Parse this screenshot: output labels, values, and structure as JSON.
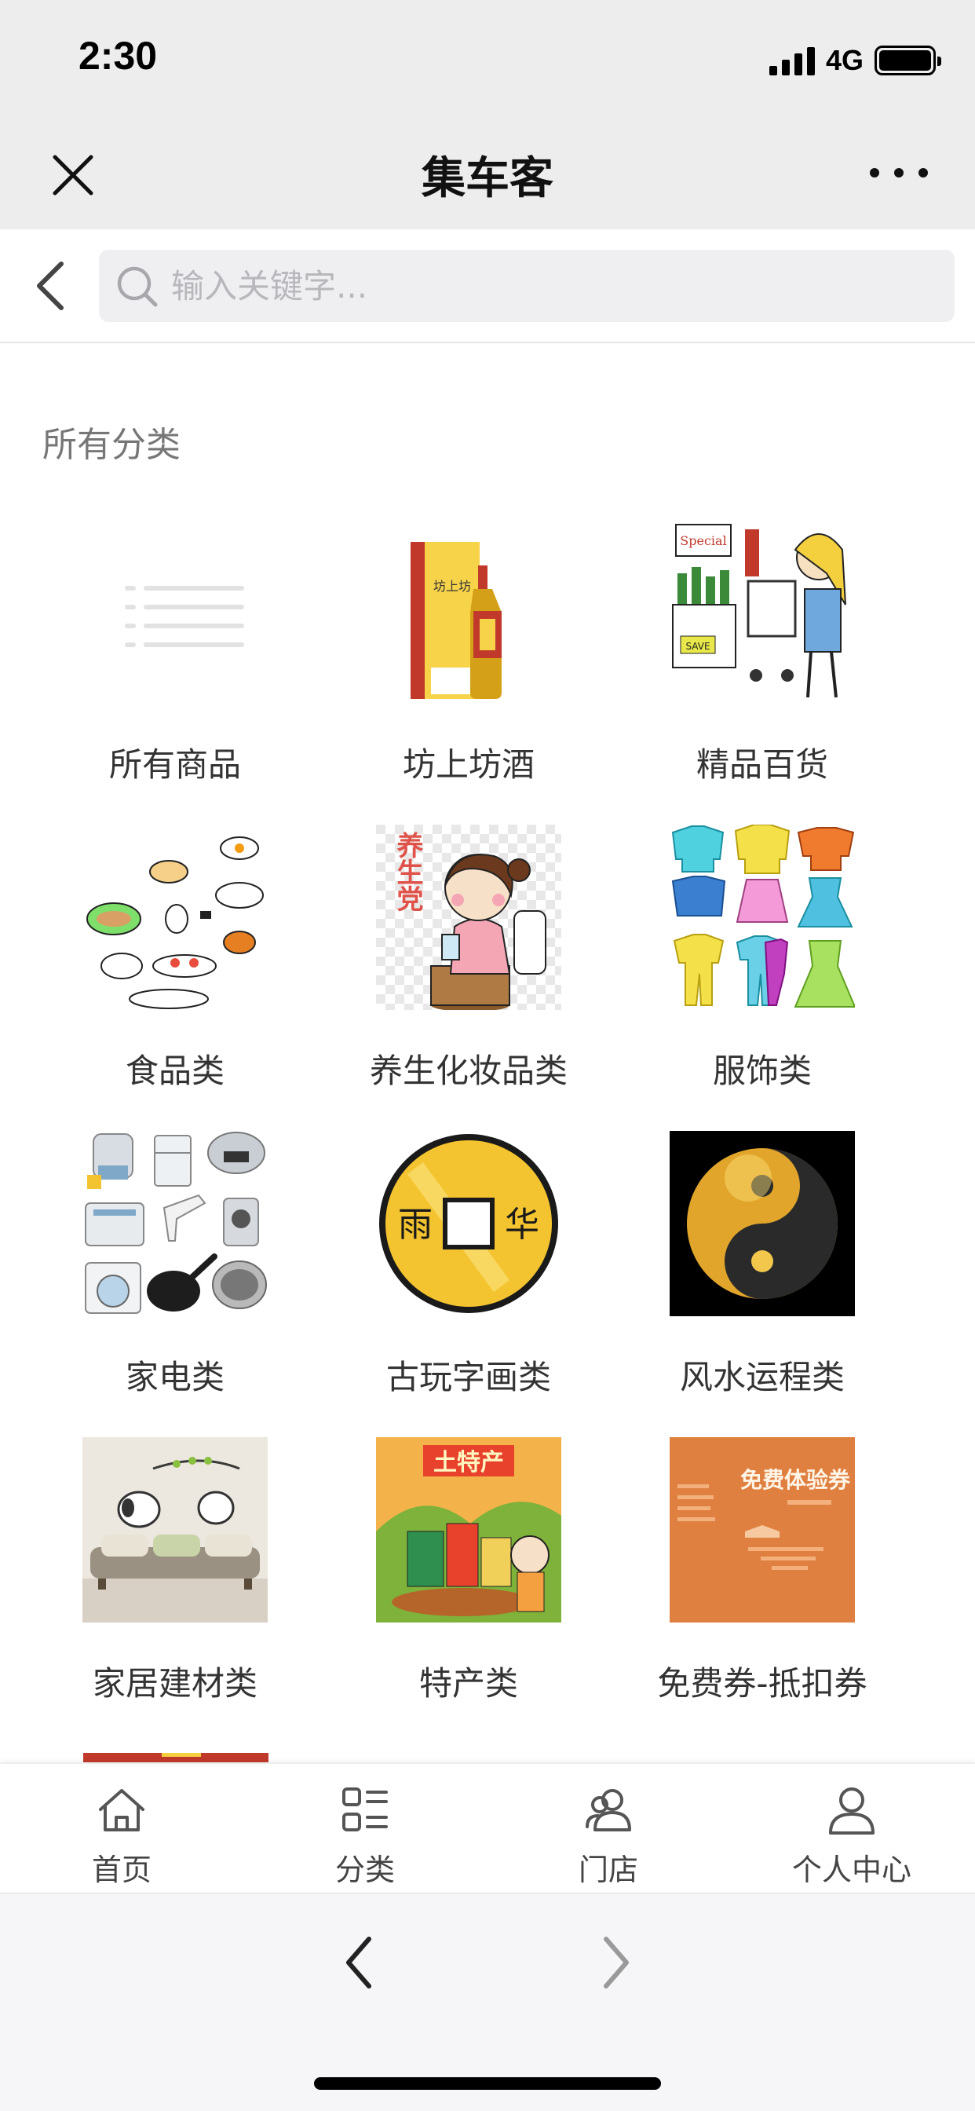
{
  "status": {
    "time": "2:30",
    "network": "4G",
    "signal_bars": 4,
    "battery_level": 0.9
  },
  "nav": {
    "title": "集车客"
  },
  "search": {
    "placeholder": "输入关键字..."
  },
  "section": {
    "title": "所有分类"
  },
  "categories": [
    {
      "label": "所有商品"
    },
    {
      "label": "坊上坊酒"
    },
    {
      "label": "精品百货"
    },
    {
      "label": "食品类"
    },
    {
      "label": "养生化妆品类"
    },
    {
      "label": "服饰类"
    },
    {
      "label": "家电类"
    },
    {
      "label": "古玩字画类"
    },
    {
      "label": "风水运程类"
    },
    {
      "label": "家居建材类"
    },
    {
      "label": "特产类"
    },
    {
      "label": "免费券-抵扣券"
    }
  ],
  "tabs": [
    {
      "label": "首页",
      "icon": "home-icon"
    },
    {
      "label": "分类",
      "icon": "category-icon"
    },
    {
      "label": "门店",
      "icon": "store-icon"
    },
    {
      "label": "个人中心",
      "icon": "user-icon"
    }
  ],
  "image_text": {
    "liquor_box": "坊上坊",
    "health_badge": "养生党",
    "coin_left": "雨",
    "coin_right": "华",
    "specialty": "土特产",
    "coupon_title": "免费体验券",
    "grocery_sign": "Special",
    "grocery_save": "SAVE"
  },
  "colors": {
    "header_bg": "#ededed",
    "search_bg": "#efeff2",
    "accent_coupon": "#e08040",
    "coin_gold": "#f4c430"
  }
}
